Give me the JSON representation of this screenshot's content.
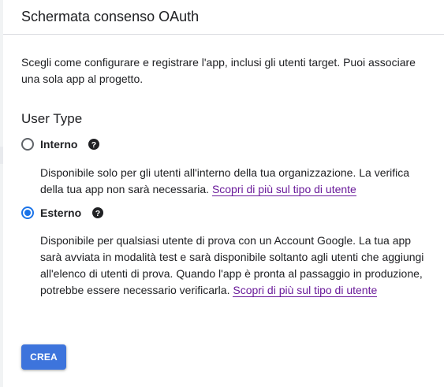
{
  "header": {
    "title": "Schermata consenso OAuth"
  },
  "intro": {
    "text": "Scegli come configurare e registrare l'app, inclusi gli utenti target. Puoi associare una sola app al progetto."
  },
  "user_type": {
    "title": "User Type",
    "options": [
      {
        "label": "Interno",
        "selected": false,
        "help_icon": "help-circle-icon",
        "description": "Disponibile solo per gli utenti all'interno della tua organizzazione. La verifica della tua app non sarà necessaria.",
        "link_text": "Scopri di più sul tipo di utente"
      },
      {
        "label": "Esterno",
        "selected": true,
        "help_icon": "help-circle-icon",
        "description": "Disponibile per qualsiasi utente di prova con un Account Google. La tua app sarà avviata in modalità test e sarà disponibile soltanto agli utenti che aggiungi all'elenco di utenti di prova. Quando l'app è pronta al passaggio in produzione, potrebbe essere necessario verificarla.",
        "link_text": "Scopri di più sul tipo di utente"
      }
    ]
  },
  "actions": {
    "create_label": "CREA"
  },
  "colors": {
    "accent": "#1a73e8",
    "button": "#3d74dc",
    "link": "#6a1b9a",
    "text": "#202124",
    "divider": "#dadce0"
  }
}
